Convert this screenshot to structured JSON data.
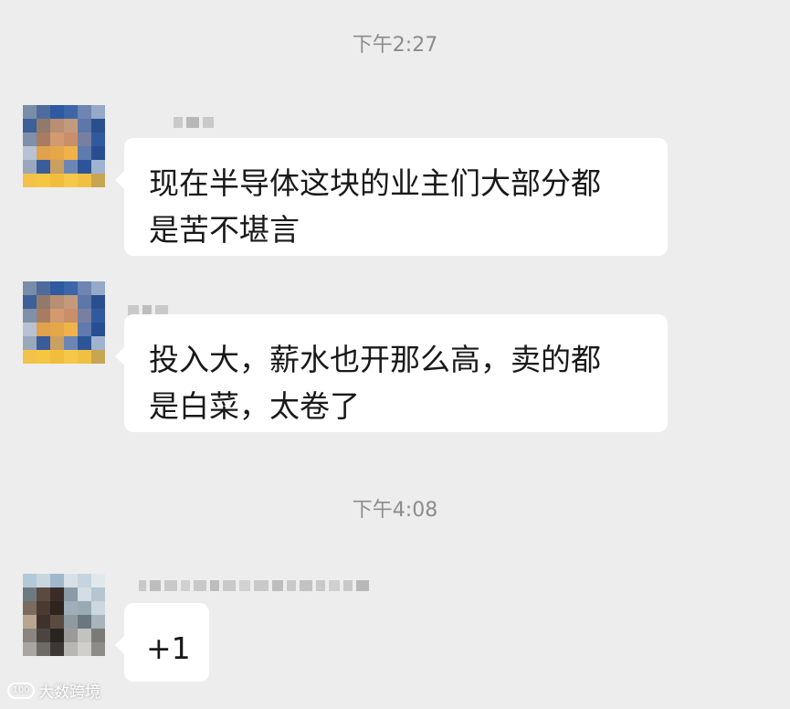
{
  "messages_section_1": {
    "timestamp": "下午2:27",
    "message_1": {
      "text_line1": "现在半导体这块的业主们大部分都",
      "text_line2": "是苦不堪言"
    },
    "message_2": {
      "text_line1": "投入大，薪水也开那么高，卖的都",
      "text_line2": "是白菜，太卷了"
    }
  },
  "messages_section_2": {
    "timestamp": "下午4:08",
    "message_3": {
      "text": "+1"
    }
  },
  "watermark": {
    "logo": "100",
    "text": "大数跨境"
  },
  "colors": {
    "background": "#ededed",
    "bubble": "#ffffff",
    "timestamp": "#8c8c8c",
    "text": "#191919"
  }
}
